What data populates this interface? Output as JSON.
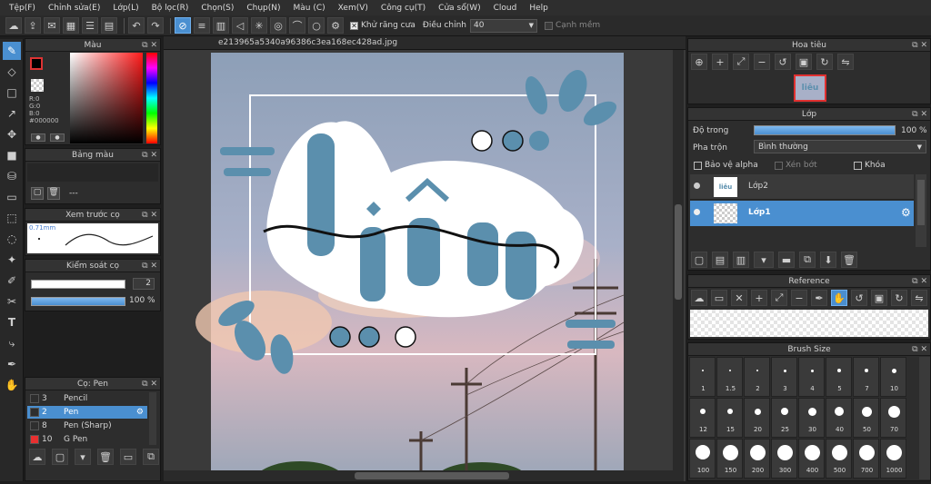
{
  "menu": [
    "Tệp(F)",
    "Chỉnh sửa(E)",
    "Lớp(L)",
    "Bộ lọc(R)",
    "Chọn(S)",
    "Chụp(N)",
    "Màu (C)",
    "Xem(V)",
    "Công cụ(T)",
    "Cửa sổ(W)",
    "Cloud",
    "Help"
  ],
  "toolbar": {
    "antialias_label": "Khử răng cưa",
    "adjust_label": "Điều chỉnh",
    "adjust_value": "40",
    "smooth_label": "Cạnh mềm"
  },
  "document": {
    "tab_title": "e213965a5340a96386c3ea168ec428ad.jpg"
  },
  "color_panel": {
    "title": "Màu",
    "r": "R:0",
    "g": "G:0",
    "b": "B:0",
    "hex": "#000000",
    "current_color": "#000000"
  },
  "palette_panel": {
    "title": "Bảng màu",
    "empty_text": "---"
  },
  "brush_preview": {
    "title": "Xem trước cọ",
    "size_text": "0.71mm"
  },
  "brush_control": {
    "title": "Kiểm soát cọ",
    "size_value": "2",
    "opacity_value": "100 %"
  },
  "brush_list": {
    "title": "Cọ: Pen",
    "items": [
      {
        "size": "3",
        "name": "Pencil",
        "color": "#2e2e2e",
        "selected": false
      },
      {
        "size": "2",
        "name": "Pen",
        "color": "#2e2e2e",
        "selected": true
      },
      {
        "size": "8",
        "name": "Pen (Sharp)",
        "color": "#2e2e2e",
        "selected": false
      },
      {
        "size": "10",
        "name": "G Pen",
        "color": "#e83030",
        "selected": false
      }
    ]
  },
  "navigator": {
    "title": "Hoa tiêu",
    "thumb_text": "liêu"
  },
  "layer_panel": {
    "title": "Lớp",
    "opacity_label": "Độ trong",
    "opacity_value": "100 %",
    "opacity_fraction": 1.0,
    "blend_label": "Pha trộn",
    "blend_value": "Bình thường",
    "protect_alpha": "Bảo vệ alpha",
    "clip": "Xén bớt",
    "lock": "Khóa",
    "layers": [
      {
        "name": "Lớp2",
        "thumb": "liêu",
        "selected": false
      },
      {
        "name": "Lớp1",
        "thumb": "",
        "selected": true
      }
    ]
  },
  "reference_panel": {
    "title": "Reference"
  },
  "brush_size_panel": {
    "title": "Brush Size",
    "sizes": [
      "1",
      "1.5",
      "2",
      "3",
      "4",
      "5",
      "7",
      "10",
      "12",
      "15",
      "20",
      "25",
      "30",
      "40",
      "50",
      "70",
      "100",
      "150",
      "200",
      "300",
      "400",
      "500",
      "700",
      "1000"
    ]
  },
  "artwork": {
    "lettering": "liêu",
    "accent": "#5b8fad"
  }
}
